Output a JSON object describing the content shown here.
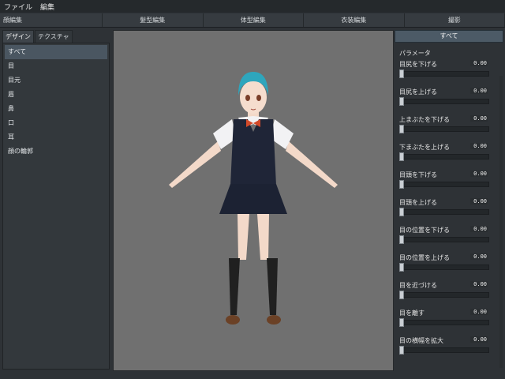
{
  "menu": {
    "file": "ファイル",
    "edit": "編集"
  },
  "mainTabs": [
    "顔編集",
    "髪型編集",
    "体型編集",
    "衣装編集",
    "撮影"
  ],
  "leftPanel": {
    "subTabs": [
      "デザイン",
      "テクスチャ"
    ],
    "items": [
      "すべて",
      "目",
      "目元",
      "眉",
      "鼻",
      "口",
      "耳",
      "顔の輪郭"
    ]
  },
  "rightPanel": {
    "allButton": "すべて",
    "header": "パラメータ",
    "params": [
      {
        "label": "目尻を下げる",
        "value": "0.00",
        "level": 0
      },
      {
        "label": "目尻を上げる",
        "value": "0.00",
        "level": 0
      },
      {
        "label": "上まぶたを下げる",
        "value": "0.00",
        "level": 0
      },
      {
        "label": "下まぶたを上げる",
        "value": "0.00",
        "level": 0
      },
      {
        "label": "目頭を下げる",
        "value": "0.00",
        "level": 0
      },
      {
        "label": "目頭を上げる",
        "value": "0.00",
        "level": 0
      },
      {
        "label": "目の位置を下げる",
        "value": "0.00",
        "level": 0
      },
      {
        "label": "目の位置を上げる",
        "value": "0.00",
        "level": 0
      },
      {
        "label": "目を近づける",
        "value": "0.00",
        "level": 0
      },
      {
        "label": "目を離す",
        "value": "0.00",
        "level": 0
      },
      {
        "label": "目の横幅を拡大",
        "value": "0.00",
        "level": 0
      }
    ]
  },
  "colors": {
    "hair": "#2ea6bd",
    "vest": "#1f2537",
    "skirt": "#1c2233",
    "shirt": "#f2f2f4",
    "bow": "#d24a2a"
  }
}
